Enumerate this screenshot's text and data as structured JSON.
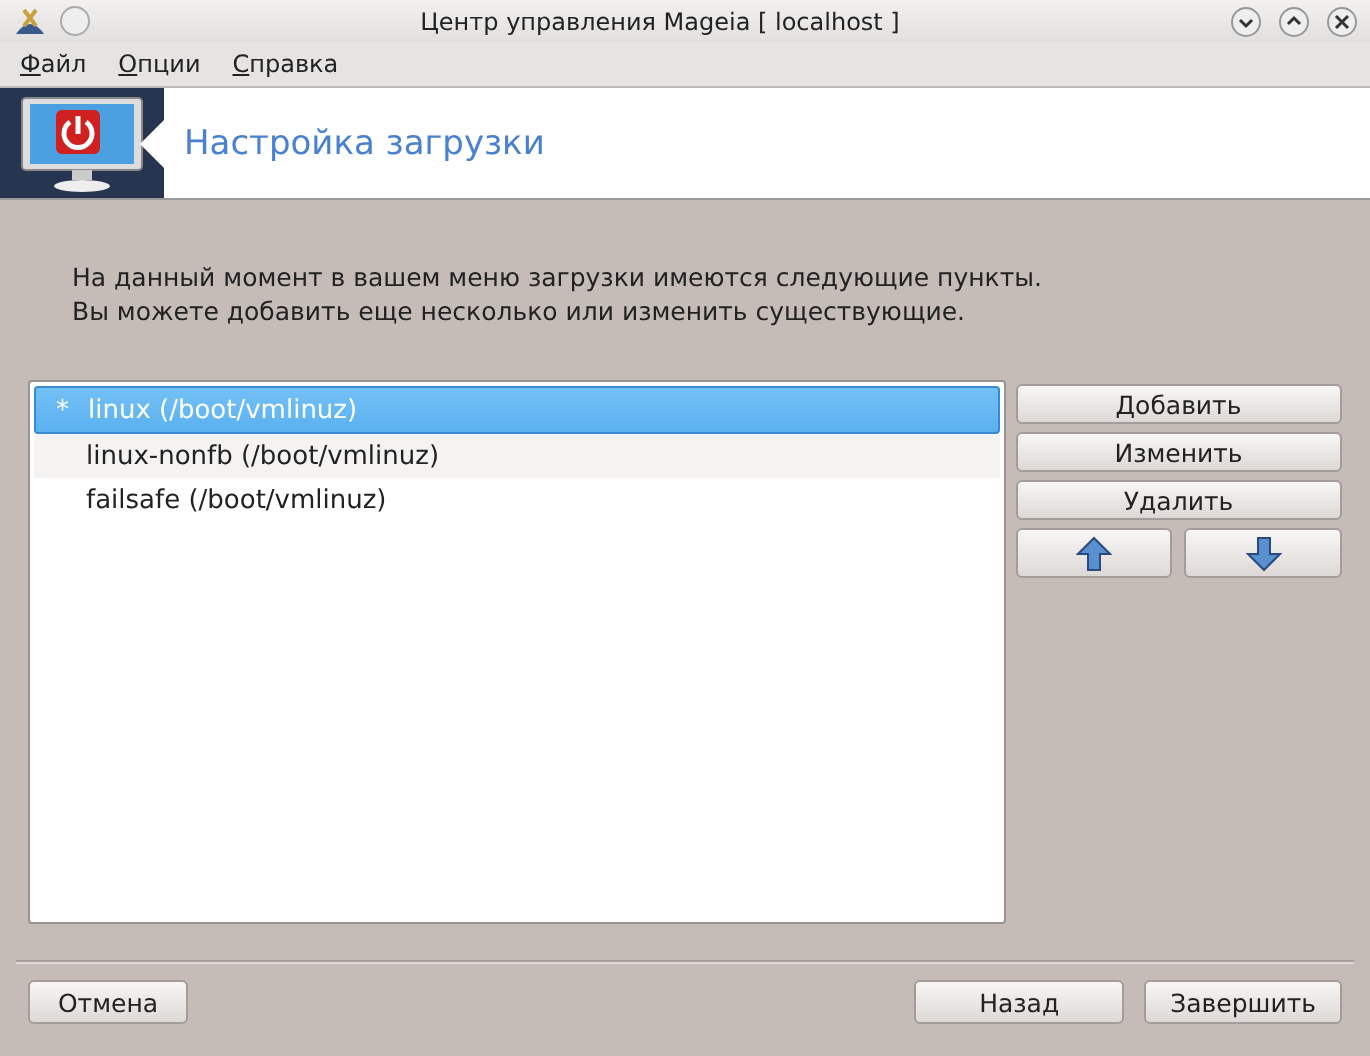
{
  "window": {
    "title": "Центр управления Mageia  [ localhost ]"
  },
  "menu": [
    {
      "label": "Файл"
    },
    {
      "label": "Опции"
    },
    {
      "label": "Справка"
    }
  ],
  "banner": {
    "title": "Настройка загрузки"
  },
  "intro": [
    "На данный момент в вашем меню загрузки имеются следующие пункты.",
    "Вы можете добавить еще несколько или изменить существующие."
  ],
  "entries": [
    {
      "marker": "*",
      "label": "linux (/boot/vmlinuz)",
      "selected": true
    },
    {
      "label": "linux-nonfb (/boot/vmlinuz)",
      "selected": false
    },
    {
      "label": "failsafe (/boot/vmlinuz)",
      "selected": false
    }
  ],
  "side_buttons": [
    "Добавить",
    "Изменить",
    "Удалить"
  ],
  "footer": {
    "left": "Отмена",
    "right": [
      "Назад",
      "Завершить"
    ]
  }
}
